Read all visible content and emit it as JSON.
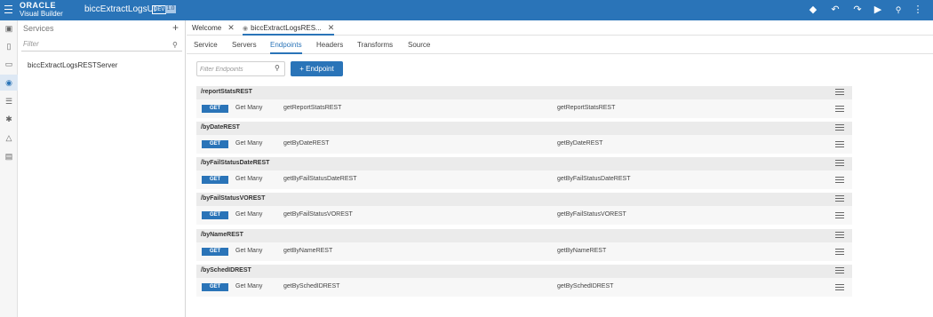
{
  "header": {
    "brand_line1": "ORACLE",
    "brand_line2": "Visual Builder",
    "app_name": "biccExtractLogsUI",
    "env_badge": "DEV",
    "version_badge": "1.0",
    "icons": [
      "diamond-icon",
      "undo-icon",
      "redo-icon",
      "run-icon",
      "search-icon",
      "more-icon"
    ]
  },
  "rail": {
    "icons": [
      "web-apps-icon",
      "mobile-apps-icon",
      "desktop-icon",
      "services-icon",
      "business-objects-icon",
      "components-icon",
      "processes-icon",
      "source-icon"
    ],
    "active_index": 3
  },
  "services": {
    "title": "Services",
    "add_glyph": "+",
    "filter_placeholder": "Filter",
    "items": [
      {
        "label": "biccExtractLogsRESTServer"
      }
    ]
  },
  "doc_tabs": [
    {
      "label": "Welcome",
      "active": false
    },
    {
      "label": "biccExtractLogsRES...",
      "active": true
    }
  ],
  "sub_tabs": [
    {
      "label": "Service",
      "active": false
    },
    {
      "label": "Servers",
      "active": false
    },
    {
      "label": "Endpoints",
      "active": true
    },
    {
      "label": "Headers",
      "active": false
    },
    {
      "label": "Transforms",
      "active": false
    },
    {
      "label": "Source",
      "active": false
    }
  ],
  "endpoints_toolbar": {
    "filter_placeholder": "Filter Endpoints",
    "add_label": "+ Endpoint"
  },
  "groups": [
    {
      "path": "/reportStatsREST",
      "method": "GET",
      "description": "Get Many",
      "id": "getReportStatsREST",
      "name": "getReportStatsREST"
    },
    {
      "path": "/byDateREST",
      "method": "GET",
      "description": "Get Many",
      "id": "getByDateREST",
      "name": "getByDateREST"
    },
    {
      "path": "/byFailStatusDateREST",
      "method": "GET",
      "description": "Get Many",
      "id": "getByFailStatusDateREST",
      "name": "getByFailStatusDateREST"
    },
    {
      "path": "/byFailStatusVOREST",
      "method": "GET",
      "description": "Get Many",
      "id": "getByFailStatusVOREST",
      "name": "getByFailStatusVOREST"
    },
    {
      "path": "/byNameREST",
      "method": "GET",
      "description": "Get Many",
      "id": "getByNameREST",
      "name": "getByNameREST"
    },
    {
      "path": "/bySchedIDREST",
      "method": "GET",
      "description": "Get Many",
      "id": "getBySchedIDREST",
      "name": "getBySchedIDREST"
    }
  ],
  "colors": {
    "accent": "#2a74b8",
    "header_bg": "#2a74b8",
    "group_bg": "#ebebeb"
  }
}
